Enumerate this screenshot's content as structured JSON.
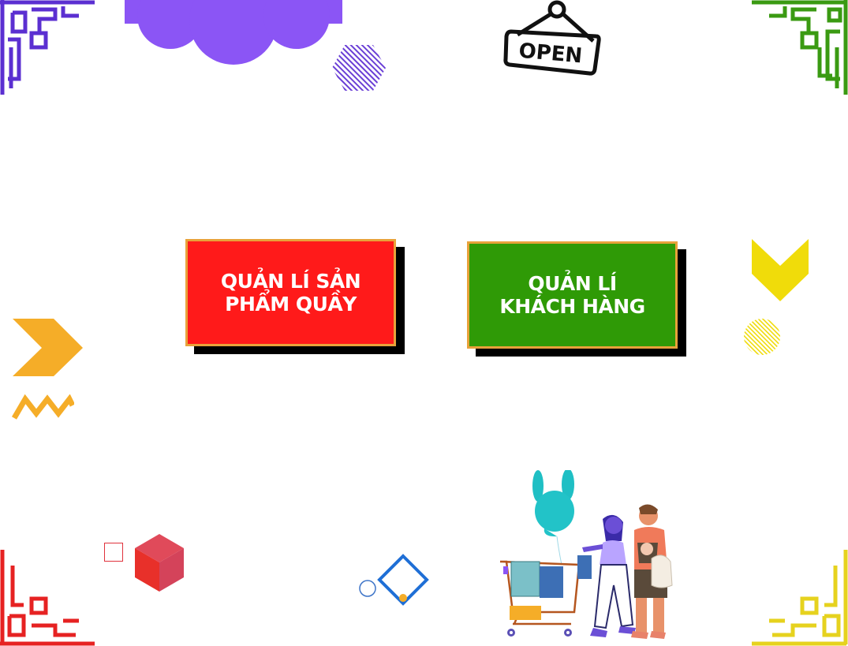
{
  "menu": {
    "products_button_label": "QUẢN LÍ SẢN\nPHẨM QUẦY",
    "customers_button_label": "QUẢN LÍ\nKHÁCH HÀNG"
  },
  "open_sign": {
    "text": "OPEN"
  },
  "colors": {
    "products_button": "#ff1a1a",
    "customers_button": "#2f9a06",
    "button_border": "#e8a23a",
    "button_shadow": "#000000",
    "corner_top_left": "#5b2fd1",
    "corner_top_right": "#3a9a12",
    "corner_bottom_left": "#e62222",
    "corner_bottom_right": "#e6d21e",
    "cloud": "#8b55f5",
    "orange_accent": "#f5ad28",
    "yellow_accent": "#f0dc0a"
  },
  "decorations": [
    "corner-ornament-icon",
    "cloud-icon",
    "hexagon-icon",
    "open-sign-icon",
    "chevron-right-icon",
    "zigzag-icon",
    "chevron-down-icon",
    "circle-icon",
    "cube-icon",
    "diamond-icon",
    "shoppers-illustration-icon"
  ]
}
